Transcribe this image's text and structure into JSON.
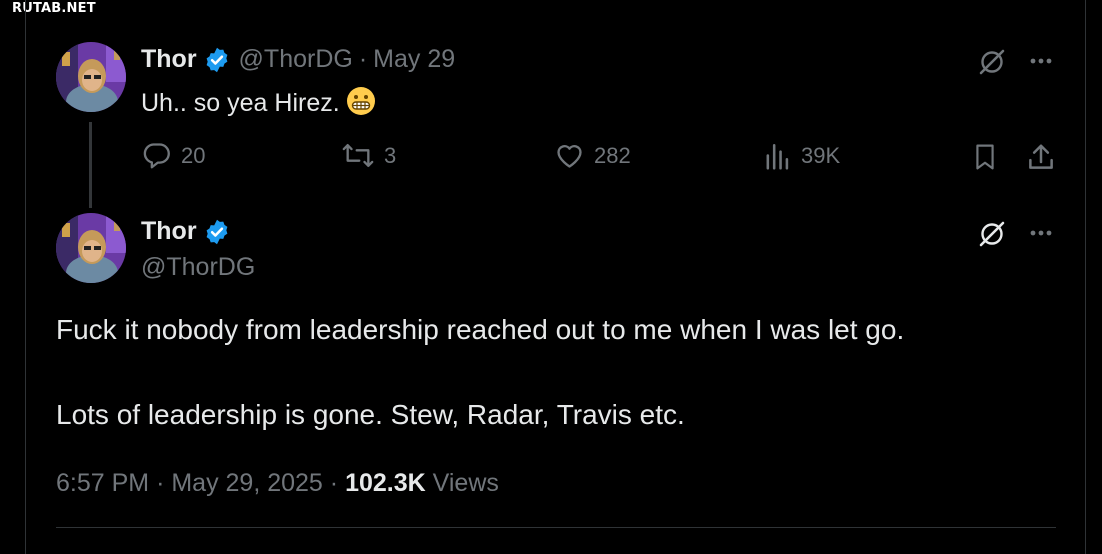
{
  "watermark": "RUTAB.NET",
  "colors": {
    "background": "#000000",
    "text": "#e7e9ea",
    "muted": "#71767b",
    "verified": "#1d9bf0",
    "border": "#2f3336"
  },
  "reply_tweet": {
    "author_name": "Thor",
    "handle": "@ThorDG",
    "separator": "·",
    "date": "May 29",
    "text": "Uh.. so yea Hirez.",
    "emoji": "grimacing-face",
    "icons": [
      "grok-icon",
      "more-icon"
    ],
    "actions": {
      "replies": "20",
      "reposts": "3",
      "likes": "282",
      "views": "39K"
    }
  },
  "main_tweet": {
    "author_name": "Thor",
    "handle": "@ThorDG",
    "line1": "Fuck it nobody from leadership reached out to me when I was let go.",
    "line2": "Lots of leadership is gone.  Stew, Radar, Travis etc.",
    "time": "6:57 PM",
    "sep1": "·",
    "date": "May 29, 2025",
    "sep2": "·",
    "views_count": "102.3K",
    "views_label": "Views"
  }
}
